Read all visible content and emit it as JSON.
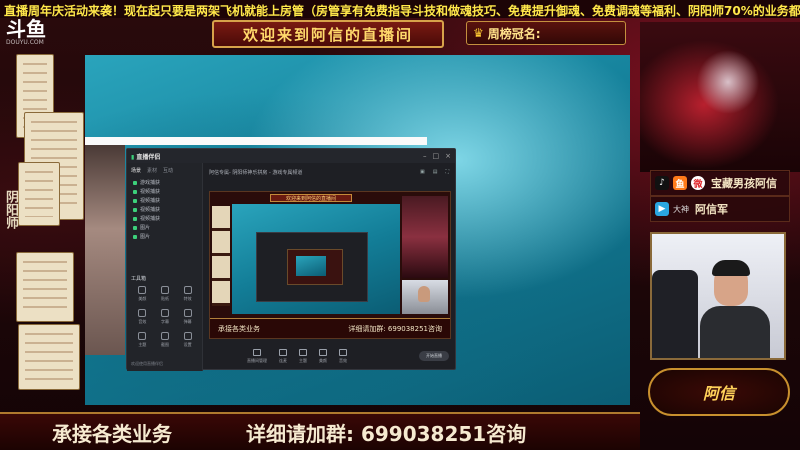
{
  "marquee": "直播周年庆活动来袭！现在起只要是两架飞机就能上房管（房管享有免费指导斗技和做魂技巧、免费提升御魂、免费调魂等福利、阴阳师70%的业务都能免费",
  "logo": {
    "name": "斗鱼",
    "sub": "DOUYU.COM"
  },
  "welcome": "欢迎来到阿信的直播间",
  "weekly": {
    "label": "周榜冠名:"
  },
  "side_vertical": "阴阳师",
  "app": {
    "title_brand": "直播伴侣",
    "tabs": [
      "场景",
      "素材",
      "互动"
    ],
    "sources": [
      "游戏捕获",
      "视频捕获",
      "视频捕获",
      "视频捕获",
      "视频捕获",
      "图片",
      "图片"
    ],
    "tools_header": "工具箱",
    "tools": [
      "美颜",
      "贴纸",
      "特效",
      "音效",
      "字幕",
      "弹幕",
      "主题",
      "截图",
      "设置"
    ],
    "head_text": "阿信专属- 阴阳师神乐拼房 - 游戏专属频道",
    "preview": {
      "banner": "欢迎来到阿信的直播间",
      "bottom_left": "承接各类业务",
      "bottom_right": "详细请加群: 699038251咨询"
    },
    "bottom_items": [
      "直播间管理",
      "连麦",
      "主题",
      "美颜",
      "音效"
    ],
    "live_btn": "开始直播",
    "footer": "欢迎使用直播伴侣"
  },
  "socials": {
    "row1_text": "宝藏男孩阿信",
    "row2_tag": "大神",
    "row2_text": "阿信军"
  },
  "badge_text": "阿信",
  "bottom_banner": {
    "left": "承接各类业务",
    "right": "详细请加群: 699038251咨询"
  },
  "colors": {
    "marquee": "#ffe84a",
    "gold": "#d7a24a",
    "water": "#1a8fa8"
  },
  "icons": [
    "tiktok-icon",
    "douyu-icon",
    "weibo-icon",
    "bilibili-icon",
    "crown-icon"
  ]
}
